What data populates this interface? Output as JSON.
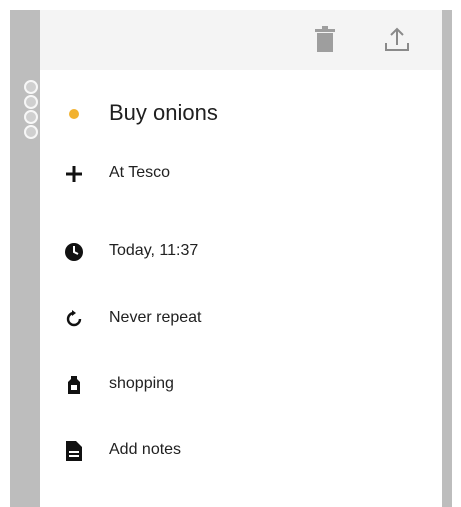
{
  "toolbar": {
    "delete_icon": "trash-icon",
    "share_icon": "share-upload-icon"
  },
  "task": {
    "title": "Buy onions",
    "priority_color": "#f2b230",
    "location": "At Tesco",
    "due": "Today, 11:37",
    "repeat": "Never repeat",
    "tag": "shopping",
    "notes_placeholder": "Add notes"
  },
  "icons": {
    "location": "plus-icon",
    "due": "clock-icon",
    "repeat": "repeat-icon",
    "tag": "tag-icon",
    "notes": "note-icon"
  }
}
